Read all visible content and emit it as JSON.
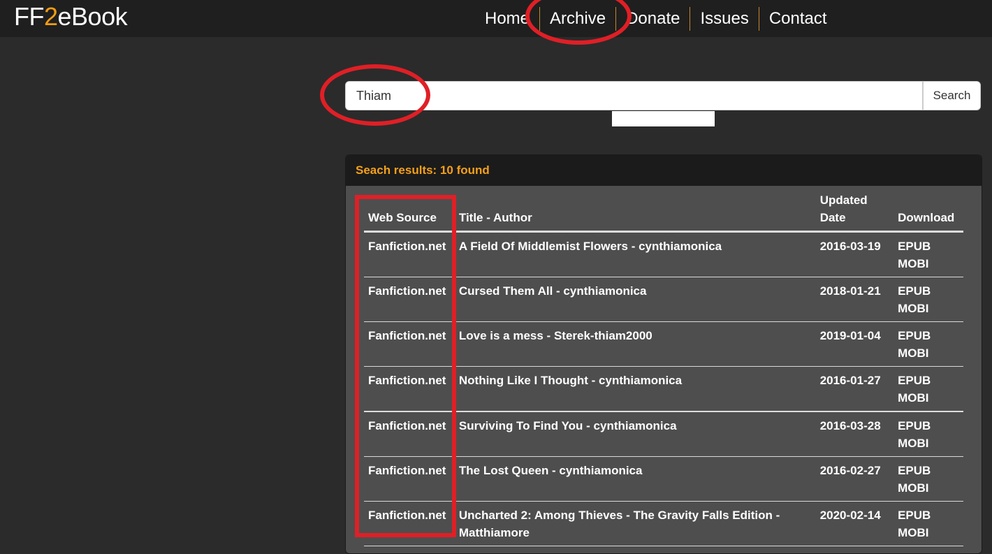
{
  "header": {
    "logo_prefix": "FF",
    "logo_two": "2",
    "logo_suffix": "eBook",
    "nav": [
      "Home",
      "Archive",
      "Donate",
      "Issues",
      "Contact"
    ]
  },
  "search": {
    "value": "Thiam",
    "button_label": "Search"
  },
  "results": {
    "summary": "Seach results: 10 found",
    "columns": [
      "Web Source",
      "Title - Author",
      "Updated Date",
      "Download"
    ],
    "rows": [
      {
        "source": "Fanfiction.net",
        "title": "A Field Of Middlemist Flowers - cynthiamonica",
        "date": "2016-03-19",
        "epub": "EPUB",
        "mobi": "MOBI"
      },
      {
        "source": "Fanfiction.net",
        "title": "Cursed Them All - cynthiamonica",
        "date": "2018-01-21",
        "epub": "EPUB",
        "mobi": "MOBI"
      },
      {
        "source": "Fanfiction.net",
        "title": "Love is a mess - Sterek-thiam2000",
        "date": "2019-01-04",
        "epub": "EPUB",
        "mobi": "MOBI"
      },
      {
        "source": "Fanfiction.net",
        "title": "Nothing Like I Thought - cynthiamonica",
        "date": "2016-01-27",
        "epub": "EPUB",
        "mobi": "MOBI"
      },
      {
        "source": "Fanfiction.net",
        "title": "Surviving To Find You - cynthiamonica",
        "date": "2016-03-28",
        "epub": "EPUB",
        "mobi": "MOBI"
      },
      {
        "source": "Fanfiction.net",
        "title": "The Lost Queen - cynthiamonica",
        "date": "2016-02-27",
        "epub": "EPUB",
        "mobi": "MOBI"
      },
      {
        "source": "Fanfiction.net",
        "title": "Uncharted 2: Among Thieves - The Gravity Falls Edition - Matthiamore",
        "date": "2020-02-14",
        "epub": "EPUB",
        "mobi": "MOBI"
      }
    ]
  },
  "colors": {
    "accent": "#f5a01a",
    "annotation": "#e01f26",
    "background": "#2b2b2b",
    "panel": "#4e4e4e"
  }
}
